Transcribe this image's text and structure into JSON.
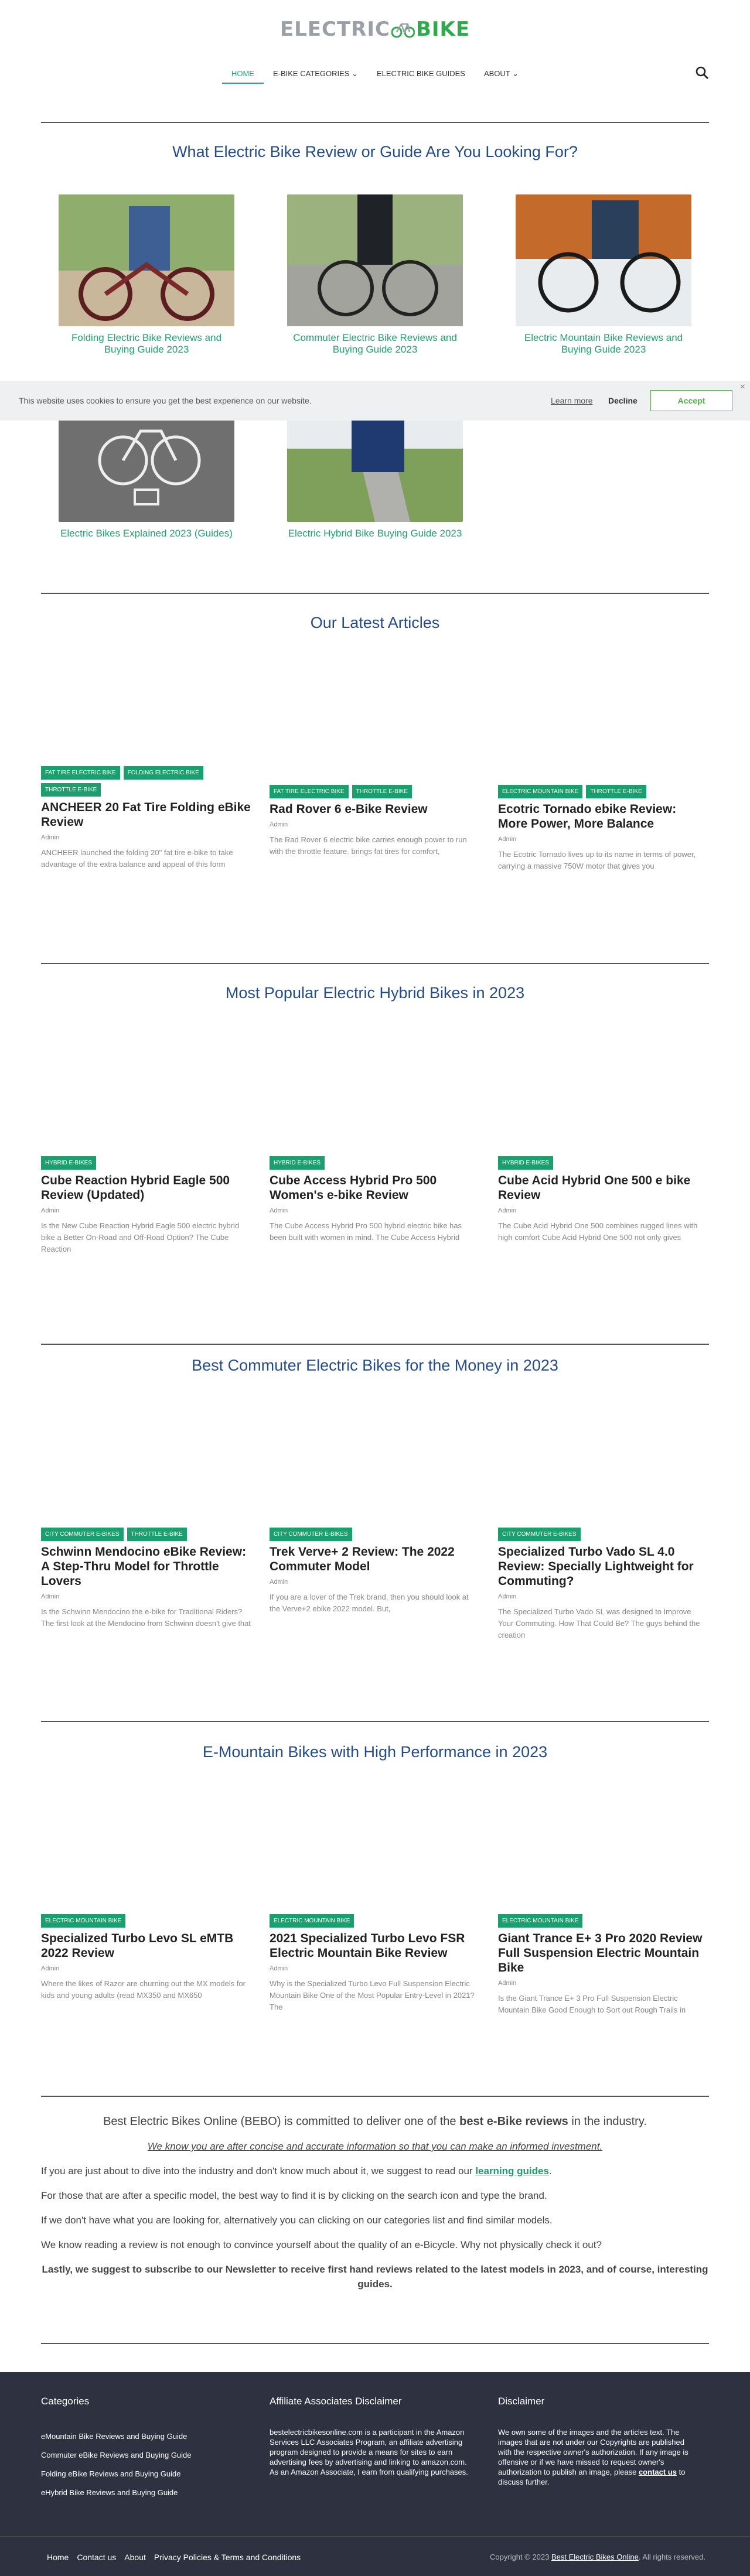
{
  "header": {
    "logo_part1": "ELECTRIC",
    "logo_part2": "BIKE",
    "nav": [
      {
        "label": "HOME"
      },
      {
        "label": "E-BIKE CATEGORIES ⌄"
      },
      {
        "label": "ELECTRIC BIKE GUIDES"
      },
      {
        "label": "ABOUT ⌄"
      }
    ]
  },
  "guides": {
    "title": "What Electric Bike Review or Guide Are You Looking For?",
    "items": [
      {
        "caption": "Folding Electric Bike Reviews and Buying Guide 2023"
      },
      {
        "caption": "Commuter Electric Bike Reviews and Buying Guide 2023"
      },
      {
        "caption": "Electric Mountain Bike Reviews and Buying Guide 2023"
      },
      {
        "caption": "Electric Bikes Explained 2023 (Guides)"
      },
      {
        "caption": "Electric Hybrid Bike Buying Guide 2023"
      }
    ]
  },
  "cookie": {
    "message": "This website uses cookies to ensure you get the best experience on our website.",
    "learn_more": "Learn more",
    "decline": "Decline",
    "accept": "Accept",
    "close": "×"
  },
  "sections": [
    {
      "title": "Our Latest Articles",
      "cards": [
        {
          "tags": [
            "FAT TIRE ELECTRIC BIKE",
            "FOLDING ELECTRIC BIKE",
            "THROTTLE E-BIKE"
          ],
          "title": "ANCHEER 20 Fat Tire Folding eBike Review",
          "author": "Admin",
          "excerpt": "ANCHEER launched the folding 20\" fat tire e-bike to take advantage of the extra balance and appeal of this form"
        },
        {
          "tags": [
            "FAT TIRE ELECTRIC BIKE",
            "THROTTLE E-BIKE"
          ],
          "title": "Rad Rover 6 e-Bike Review",
          "author": "Admin",
          "excerpt": "The Rad Rover 6 electric bike carries enough power to run with the throttle feature. brings fat tires for comfort,"
        },
        {
          "tags": [
            "ELECTRIC MOUNTAIN BIKE",
            "THROTTLE E-BIKE"
          ],
          "title": "Ecotric Tornado ebike Review: More Power, More Balance",
          "author": "Admin",
          "excerpt": "The Ecotric Tornado lives up to its name in terms of power, carrying a massive 750W motor that gives you"
        }
      ]
    },
    {
      "title": "Most Popular Electric Hybrid Bikes in 2023",
      "cards": [
        {
          "tags": [
            "HYBRID E-BIKES"
          ],
          "title": "Cube Reaction Hybrid Eagle 500 Review (Updated)",
          "author": "Admin",
          "excerpt": "Is the New Cube Reaction Hybrid Eagle 500 electric hybrid bike a Better On-Road and Off-Road Option? The Cube Reaction"
        },
        {
          "tags": [
            "HYBRID E-BIKES"
          ],
          "title": "Cube Access Hybrid Pro 500 Women's e-bike Review",
          "author": "Admin",
          "excerpt": " The Cube Access Hybrid Pro 500 hybrid electric bike has been built with women in mind. The Cube Access Hybrid"
        },
        {
          "tags": [
            "HYBRID E-BIKES"
          ],
          "title": "Cube Acid Hybrid One 500 e bike Review",
          "author": "Admin",
          "excerpt": "The Cube Acid Hybrid One 500 combines rugged lines with high comfort Cube Acid Hybrid One 500 not only gives"
        }
      ]
    },
    {
      "title": "Best Commuter Electric Bikes for the Money in 2023",
      "cards": [
        {
          "tags": [
            "CITY COMMUTER E-BIKES",
            "THROTTLE E-BIKE"
          ],
          "title": "Schwinn Mendocino eBike Review: A Step-Thru Model for Throttle Lovers",
          "author": "Admin",
          "excerpt": "Is the Schwinn Mendocino the e-bike for Traditional Riders? The first look at the Mendocino from Schwinn doesn't give that"
        },
        {
          "tags": [
            "CITY COMMUTER E-BIKES"
          ],
          "title": "Trek Verve+ 2 Review: The 2022 Commuter Model",
          "author": "Admin",
          "excerpt": "If you are a lover of the Trek brand, then you should look at the Verve+2 ebike 2022 model. But,"
        },
        {
          "tags": [
            "CITY COMMUTER E-BIKES"
          ],
          "title": "Specialized Turbo Vado SL 4.0 Review: Specially Lightweight for Commuting?",
          "author": "Admin",
          "excerpt": "The Specialized Turbo Vado SL was designed to Improve Your Commuting. How That Could Be? The guys behind the creation"
        }
      ]
    },
    {
      "title": "E-Mountain Bikes with High Performance in 2023",
      "cards": [
        {
          "tags": [
            "ELECTRIC MOUNTAIN BIKE"
          ],
          "title": "Specialized Turbo Levo SL eMTB 2022 Review",
          "author": "Admin",
          "excerpt": "Where the likes of Razor are churning out the MX models for kids and young adults (read MX350 and MX650"
        },
        {
          "tags": [
            "ELECTRIC MOUNTAIN BIKE"
          ],
          "title": "2021 Specialized Turbo Levo FSR Electric Mountain Bike Review",
          "author": "Admin",
          "excerpt": "Why is the Specialized Turbo Levo Full Suspension Electric Mountain Bike One of the Most Popular Entry-Level in 2021? The"
        },
        {
          "tags": [
            "ELECTRIC MOUNTAIN BIKE"
          ],
          "title": "Giant Trance E+ 3 Pro 2020 Review Full Suspension Electric Mountain Bike",
          "author": "Admin",
          "excerpt": "Is the Giant Trance E+ 3 Pro Full Suspension Electric Mountain Bike Good Enough to Sort out Rough Trails in"
        }
      ]
    }
  ],
  "about": {
    "p1_before": "Best Electric Bikes Online (BEBO) is committed to deliver one of the ",
    "p1_bold": "best e-Bike reviews",
    "p1_after": " in the industry.",
    "p2": "We know you are after concise and accurate information so that you can make an informed investment.",
    "p3_before": "If you are just about to dive into the industry and don't know much about it, we suggest to read our ",
    "p3_link": "learning guides",
    "p3_after": ".",
    "p4": "For those that are after a specific model, the best way to find it is by clicking on the search icon and type the brand.",
    "p5": "If we don't have what you are looking for, alternatively you can clicking on our categories list and find similar models.",
    "p6": "We know reading a review is not enough to convince yourself about the quality of an e-Bicycle. Why not physically check it out?",
    "p7": "Lastly, we suggest to subscribe to our Newsletter to receive first hand reviews related to the latest models in 2023, and of course, interesting guides."
  },
  "footer": {
    "categories_title": "Categories",
    "categories": [
      "eMountain Bike Reviews and Buying Guide",
      "Commuter eBike Reviews and Buying Guide",
      "Folding eBike Reviews and Buying Guide",
      "eHybrid Bike Reviews and Buying Guide"
    ],
    "affiliate_title": "Affiliate Associates Disclaimer",
    "affiliate_text": "bestelectricbikesonline.com is a participant in the Amazon Services LLC Associates Program, an affiliate advertising program designed to provide a means for sites to earn advertising fees by advertising and linking to amazon.com. As an Amazon Associate, I earn from qualifying purchases.",
    "disclaimer_title": "Disclaimer",
    "disclaimer_text": "We own some of the images and the articles text. The images that are not under our Copyrights are published with the respective owner's authorization. If any image is offensive or if we have missed to request owner's authorization to publish an image, please",
    "disclaimer_link": "contact us",
    "disclaimer_after": " to discuss further.",
    "bottom_links": [
      "Home",
      "Contact us",
      "About",
      "Privacy Policies & Terms and Conditions"
    ],
    "copyright_before": "Copyright © 2023 ",
    "copyright_link": "Best Electric Bikes Online",
    "copyright_after": ". All rights reserved."
  },
  "colors": {
    "accent": "#1b9f6e",
    "title_blue": "#234c8c",
    "footer_bg": "#2e313f"
  }
}
